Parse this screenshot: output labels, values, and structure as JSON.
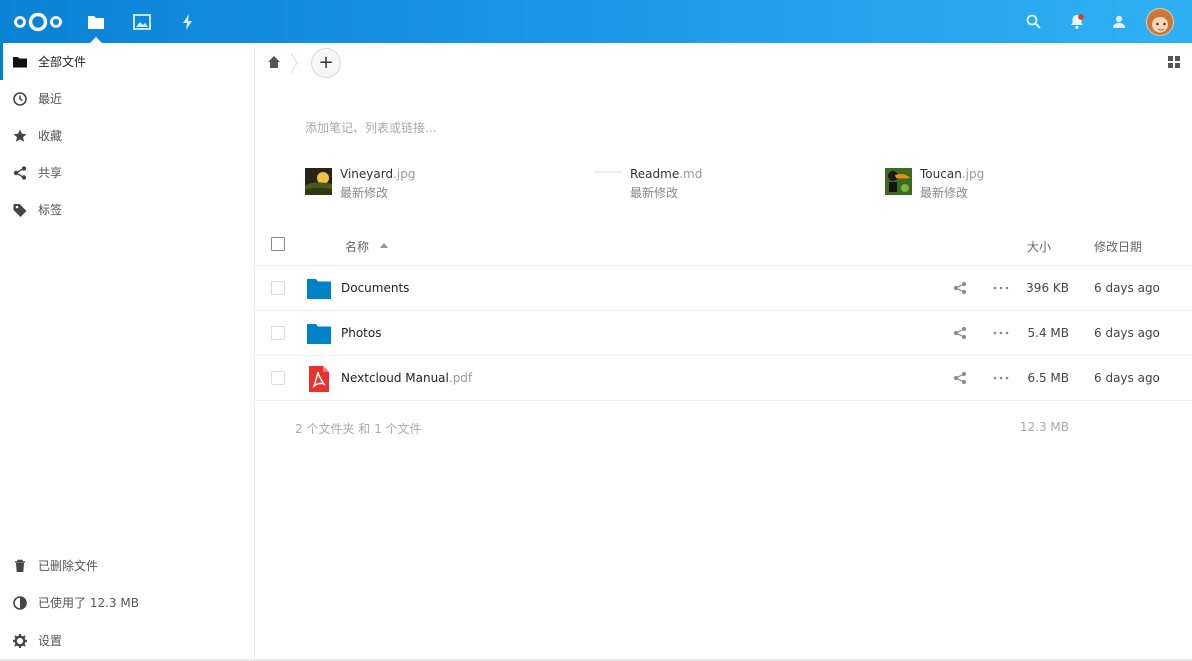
{
  "header": {
    "apps": [
      {
        "name": "Files",
        "icon": "folder-icon",
        "active": true
      },
      {
        "name": "Photos",
        "icon": "image-icon",
        "active": false
      },
      {
        "name": "Activity",
        "icon": "lightning-icon",
        "active": false
      }
    ],
    "accent_color": "#0082c9"
  },
  "sidebar": {
    "items": [
      {
        "label": "全部文件",
        "icon": "folder-icon"
      },
      {
        "label": "最近",
        "icon": "clock-icon"
      },
      {
        "label": "收藏",
        "icon": "star-icon"
      },
      {
        "label": "共享",
        "icon": "share-icon"
      },
      {
        "label": "标签",
        "icon": "tag-icon"
      }
    ],
    "footer": [
      {
        "label": "已删除文件",
        "icon": "trash-icon"
      },
      {
        "label": "已使用了 12.3 MB",
        "icon": "pie-chart-icon"
      },
      {
        "label": "设置",
        "icon": "gear-icon"
      }
    ]
  },
  "main": {
    "new_button": "+",
    "notes_placeholder": "添加笔记、列表或链接...",
    "recent": [
      {
        "base": "Vineyard",
        "ext": ".jpg",
        "sub": "最新修改"
      },
      {
        "base": "Readme",
        "ext": ".md",
        "sub": "最新修改"
      },
      {
        "base": "Toucan",
        "ext": ".jpg",
        "sub": "最新修改"
      }
    ],
    "table": {
      "col_name": "名称",
      "col_size": "大小",
      "col_date": "修改日期",
      "rows": [
        {
          "base": "Documents",
          "ext": "",
          "size": "396 KB",
          "date": "6 days ago",
          "type": "folder"
        },
        {
          "base": "Photos",
          "ext": "",
          "size": "5.4 MB",
          "date": "6 days ago",
          "type": "folder"
        },
        {
          "base": "Nextcloud Manual",
          "ext": ".pdf",
          "size": "6.5 MB",
          "date": "6 days ago",
          "type": "pdf"
        }
      ],
      "summary": "2 个文件夹 和 1 个文件",
      "summary_size": "12.3 MB"
    }
  }
}
